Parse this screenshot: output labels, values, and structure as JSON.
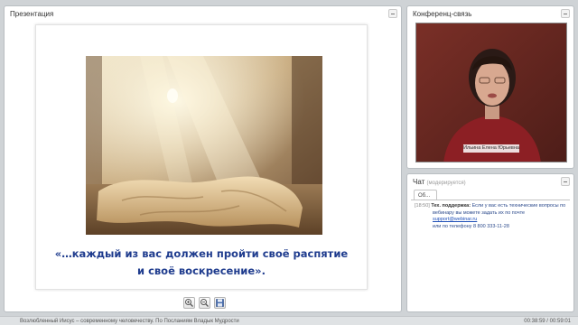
{
  "presentation": {
    "title": "Презентация",
    "quote_line1": "«…каждый из вас должен пройти своё распятие",
    "quote_line2": "и своё воскресение»."
  },
  "toolbar": {
    "buttons": [
      {
        "icon": "zoom-in-icon"
      },
      {
        "icon": "zoom-out-icon"
      },
      {
        "icon": "save-icon"
      }
    ]
  },
  "conference": {
    "title": "Конференц-связь",
    "speaker_name": "Ильина Елена Юрьевна"
  },
  "chat": {
    "title": "Чат",
    "subtitle": "(модерируется)",
    "tab_label": "Об...",
    "messages": [
      {
        "time": "[18:50]",
        "author": "Тех. поддержка:",
        "text_part1": "Если у вас есть технические вопросы по",
        "text_part2": "вебинару вы можете задать их по почте",
        "link": "support@webinar.ru",
        "text_part3": "или по телефону 8 800 333-11-28"
      }
    ]
  },
  "statusbar": {
    "title": "Возлюбленный Иисус – современному человечеству. По Посланиям Владык Мудрости",
    "time": "00:38:59 / 00:59:01"
  },
  "colors": {
    "background": "#cfd3d6",
    "quote": "#1f3c8e",
    "link": "#1f4fb8"
  }
}
